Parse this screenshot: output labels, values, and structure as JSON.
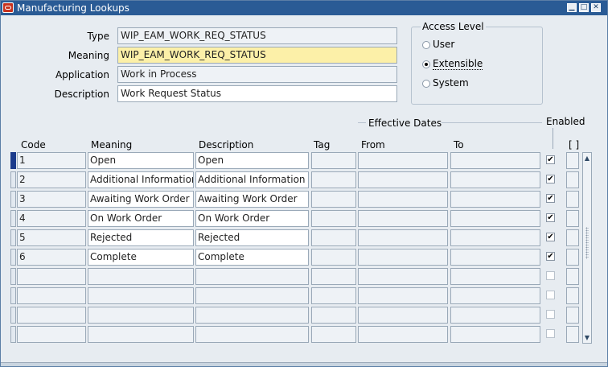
{
  "window": {
    "title": "Manufacturing Lookups",
    "controls": {
      "minimize": "▁",
      "maximize": "□",
      "close": "✕"
    }
  },
  "header_fields": [
    {
      "label": "Type",
      "value": "WIP_EAM_WORK_REQ_STATUS",
      "style": "gray"
    },
    {
      "label": "Meaning",
      "value": "WIP_EAM_WORK_REQ_STATUS",
      "style": "yellow"
    },
    {
      "label": "Application",
      "value": "Work in Process",
      "style": "gray"
    },
    {
      "label": "Description",
      "value": "Work Request Status",
      "style": "white"
    }
  ],
  "access_level": {
    "label": "Access Level",
    "options": [
      {
        "label": "User",
        "selected": false
      },
      {
        "label": "Extensible",
        "selected": true
      },
      {
        "label": "System",
        "selected": false
      }
    ]
  },
  "table": {
    "effective_dates_label": "Effective Dates",
    "enabled_label": "Enabled",
    "flex_label": "[ ]",
    "columns": {
      "code": "Code",
      "meaning": "Meaning",
      "description": "Description",
      "tag": "Tag",
      "from": "From",
      "to": "To"
    },
    "rows": [
      {
        "code": "1",
        "meaning": "Open",
        "description": "Open",
        "tag": "",
        "from": "",
        "to": "",
        "enabled": true
      },
      {
        "code": "2",
        "meaning": "Additional Information",
        "description": "Additional Information",
        "tag": "",
        "from": "",
        "to": "",
        "enabled": true
      },
      {
        "code": "3",
        "meaning": "Awaiting Work Order",
        "description": "Awaiting Work Order",
        "tag": "",
        "from": "",
        "to": "",
        "enabled": true
      },
      {
        "code": "4",
        "meaning": "On Work Order",
        "description": "On Work Order",
        "tag": "",
        "from": "",
        "to": "",
        "enabled": true
      },
      {
        "code": "5",
        "meaning": "Rejected",
        "description": "Rejected",
        "tag": "",
        "from": "",
        "to": "",
        "enabled": true
      },
      {
        "code": "6",
        "meaning": "Complete",
        "description": "Complete",
        "tag": "",
        "from": "",
        "to": "",
        "enabled": true
      },
      {
        "code": "",
        "meaning": "",
        "description": "",
        "tag": "",
        "from": "",
        "to": "",
        "enabled": false
      },
      {
        "code": "",
        "meaning": "",
        "description": "",
        "tag": "",
        "from": "",
        "to": "",
        "enabled": false
      },
      {
        "code": "",
        "meaning": "",
        "description": "",
        "tag": "",
        "from": "",
        "to": "",
        "enabled": false
      },
      {
        "code": "",
        "meaning": "",
        "description": "",
        "tag": "",
        "from": "",
        "to": "",
        "enabled": false
      }
    ],
    "check_glyph": "✔",
    "scroll_up": "▲",
    "scroll_down": "▼"
  }
}
